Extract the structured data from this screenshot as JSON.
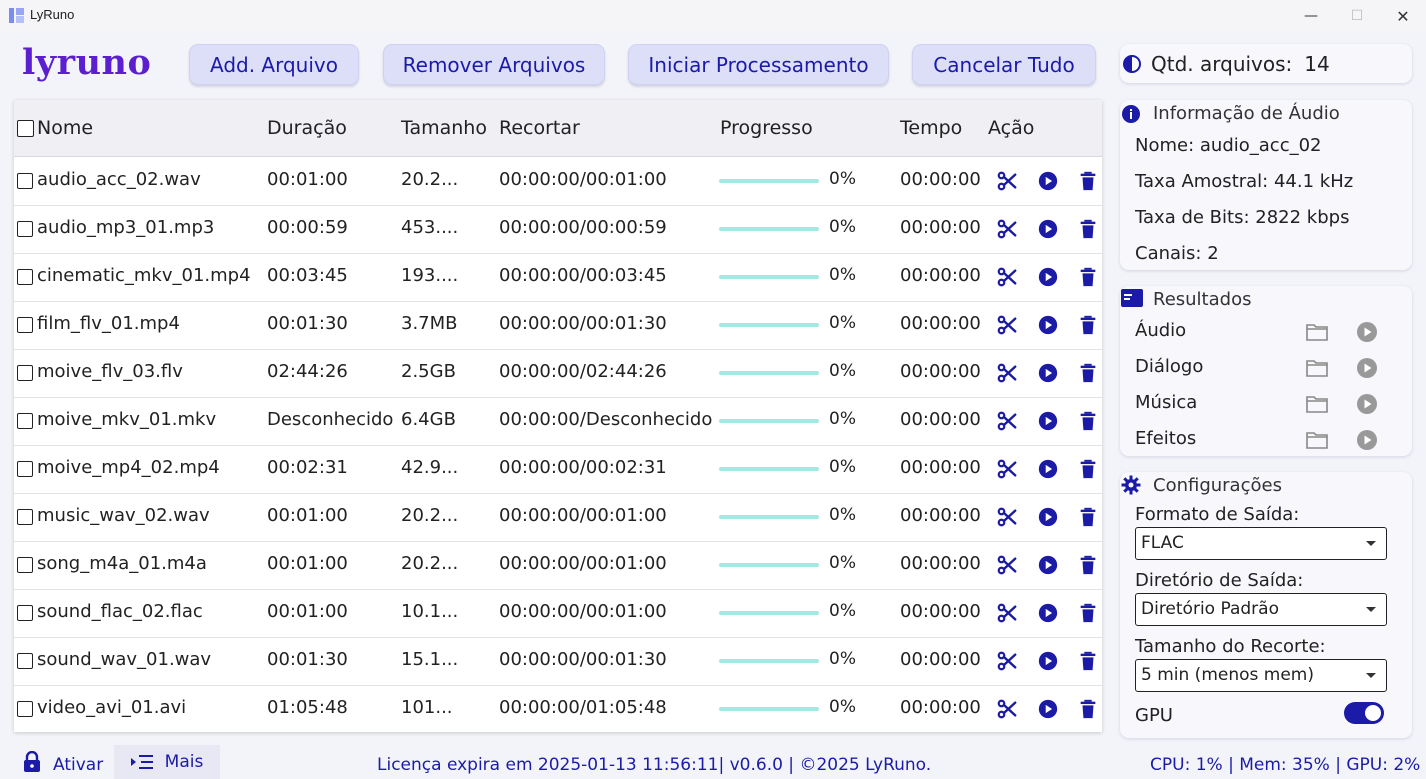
{
  "window": {
    "title": "LyRuno",
    "minimize_glyph": "—",
    "maximize_glyph": "☐",
    "close_glyph": "✕"
  },
  "toolbar": {
    "logo": "lyruno",
    "add_label": "Add. Arquivo",
    "remove_label": "Remover Arquivos",
    "start_label": "Iniciar Processamento",
    "cancel_label": "Cancelar Tudo",
    "qtd_label": "Qtd. arquivos:",
    "qtd_value": "14"
  },
  "table": {
    "headers": {
      "name": "Nome",
      "duration": "Duração",
      "size": "Tamanho",
      "trim": "Recortar",
      "progress": "Progresso",
      "time": "Tempo",
      "action": "Ação"
    },
    "rows": [
      {
        "name": "audio_acc_02.wav",
        "duration": "00:01:00",
        "size": "20.2...",
        "trim": "00:00:00/00:01:00",
        "progress": "0%",
        "time": "00:00:00"
      },
      {
        "name": "audio_mp3_01.mp3",
        "duration": "00:00:59",
        "size": "453....",
        "trim": "00:00:00/00:00:59",
        "progress": "0%",
        "time": "00:00:00"
      },
      {
        "name": "cinematic_mkv_01.mp4",
        "duration": "00:03:45",
        "size": "193....",
        "trim": "00:00:00/00:03:45",
        "progress": "0%",
        "time": "00:00:00"
      },
      {
        "name": "film_flv_01.mp4",
        "duration": "00:01:30",
        "size": "3.7MB",
        "trim": "00:00:00/00:01:30",
        "progress": "0%",
        "time": "00:00:00"
      },
      {
        "name": "moive_flv_03.flv",
        "duration": "02:44:26",
        "size": "2.5GB",
        "trim": "00:00:00/02:44:26",
        "progress": "0%",
        "time": "00:00:00"
      },
      {
        "name": "moive_mkv_01.mkv",
        "duration": "Desconhecido",
        "size": "6.4GB",
        "trim": "00:00:00/Desconhecido",
        "progress": "0%",
        "time": "00:00:00"
      },
      {
        "name": "moive_mp4_02.mp4",
        "duration": "00:02:31",
        "size": "42.9...",
        "trim": "00:00:00/00:02:31",
        "progress": "0%",
        "time": "00:00:00"
      },
      {
        "name": "music_wav_02.wav",
        "duration": "00:01:00",
        "size": "20.2...",
        "trim": "00:00:00/00:01:00",
        "progress": "0%",
        "time": "00:00:00"
      },
      {
        "name": "song_m4a_01.m4a",
        "duration": "00:01:00",
        "size": "20.2...",
        "trim": "00:00:00/00:01:00",
        "progress": "0%",
        "time": "00:00:00"
      },
      {
        "name": "sound_flac_02.flac",
        "duration": "00:01:00",
        "size": "10.1...",
        "trim": "00:00:00/00:01:00",
        "progress": "0%",
        "time": "00:00:00"
      },
      {
        "name": "sound_wav_01.wav",
        "duration": "00:01:30",
        "size": "15.1...",
        "trim": "00:00:00/00:01:30",
        "progress": "0%",
        "time": "00:00:00"
      },
      {
        "name": "video_avi_01.avi",
        "duration": "01:05:48",
        "size": "101...",
        "trim": "00:00:00/01:05:48",
        "progress": "0%",
        "time": "00:00:00"
      }
    ]
  },
  "audio_info": {
    "title": "Informação de Áudio",
    "name_label": "Nome:",
    "name_value": "audio_acc_02",
    "rate_label": "Taxa Amostral:",
    "rate_value": "44.1 kHz",
    "bits_label": "Taxa de Bits:",
    "bits_value": "2822 kbps",
    "channels_label": "Canais:",
    "channels_value": "2"
  },
  "results": {
    "title": "Resultados",
    "items": [
      "Áudio",
      "Diálogo",
      "Música",
      "Efeitos"
    ]
  },
  "settings": {
    "title": "Configurações",
    "format_label": "Formato de Saída:",
    "format_value": "FLAC",
    "dir_label": "Diretório de Saída:",
    "dir_value": "Diretório Padrão",
    "clip_label": "Tamanho do Recorte:",
    "clip_value": "5 min (menos mem)",
    "gpu_label": "GPU",
    "gpu_on": true
  },
  "footer": {
    "activate_label": "Ativar",
    "more_label": "Mais",
    "license_text": "Licença expira em 2025-01-13 11:56:11| v0.6.0 | ©2025 LyRuno.",
    "stats_text": "CPU: 1% | Mem: 35% | GPU: 2%"
  },
  "colors": {
    "accent": "#1b1ba8",
    "logo": "#5b1fd0",
    "button_bg": "#dddff8",
    "progress_track": "#a8e6e2"
  }
}
